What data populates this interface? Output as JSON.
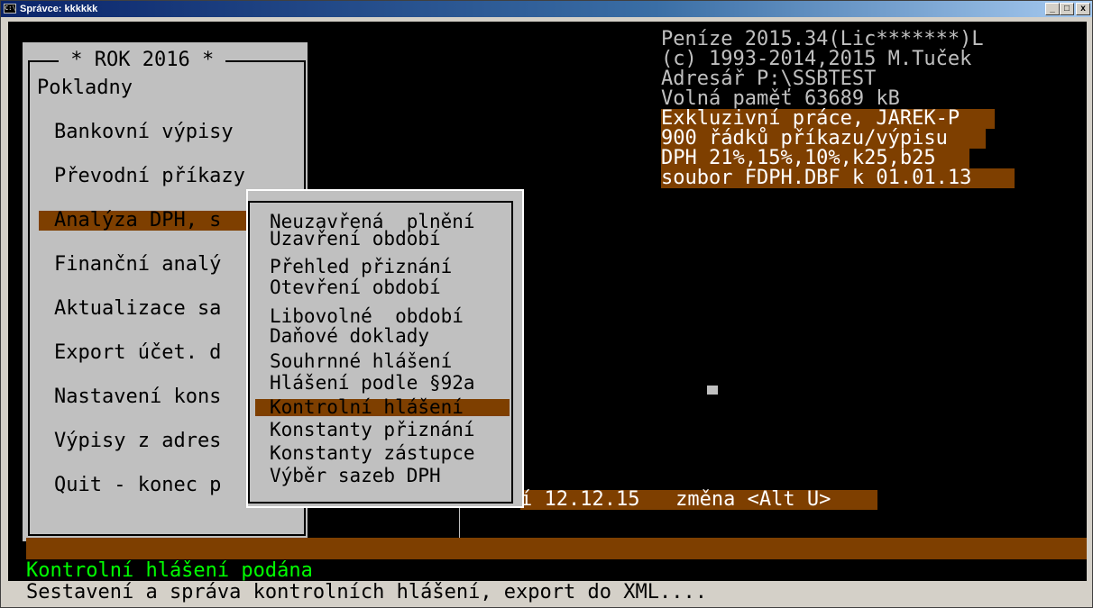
{
  "window": {
    "title": "Správce: kkkkkk",
    "app_icon": "console-icon",
    "controls": {
      "minimize": "_",
      "maximize": "□",
      "close": "x"
    }
  },
  "info": {
    "line1": "Peníze 2015.34(Lic*******)L",
    "line2": "(c) 1993-2014,2015 M.Tuček",
    "line3": "Adresář P:\\SSBTEST",
    "line4": "Volná paměť 63689 kB",
    "line5": "Exkluzivní práce, JAREK-P",
    "line6": "900 řádků příkazu/výpisu",
    "line7": "DPH 21%,15%,10%,k25,b25",
    "line8": "soubor FDPH.DBF k 01.01.13"
  },
  "main_menu": {
    "title": " * ROK 2016 * ",
    "items": [
      "Pokladny",
      "Bankovní výpisy",
      "Převodní příkazy",
      "Analýza DPH, s",
      "Finanční analý",
      "Aktualizace sa",
      "Export účet. d",
      "Nastavení kons",
      "Výpisy z adres",
      "Quit - konec p"
    ],
    "selected_index": 3
  },
  "submenu": {
    "items": [
      "Neuzavřená  plnění",
      "Uzavření období",
      "Přehled přiznání",
      "Otevření období",
      "Libovolné  období",
      "Daňové doklady",
      "Souhrnné hlášení",
      "Hlášení podle §92a",
      "Kontrolní hlášení",
      "Konstanty přiznání",
      "Konstanty zástupce",
      "Výběr sazeb DPH"
    ],
    "selected_index": 8
  },
  "date_line": "í 12.12.15   změna <Alt U>",
  "message": "Kontrolní hlášení podána",
  "hint": "Sestavení a správa kontrolních hlášení, export do XML...."
}
